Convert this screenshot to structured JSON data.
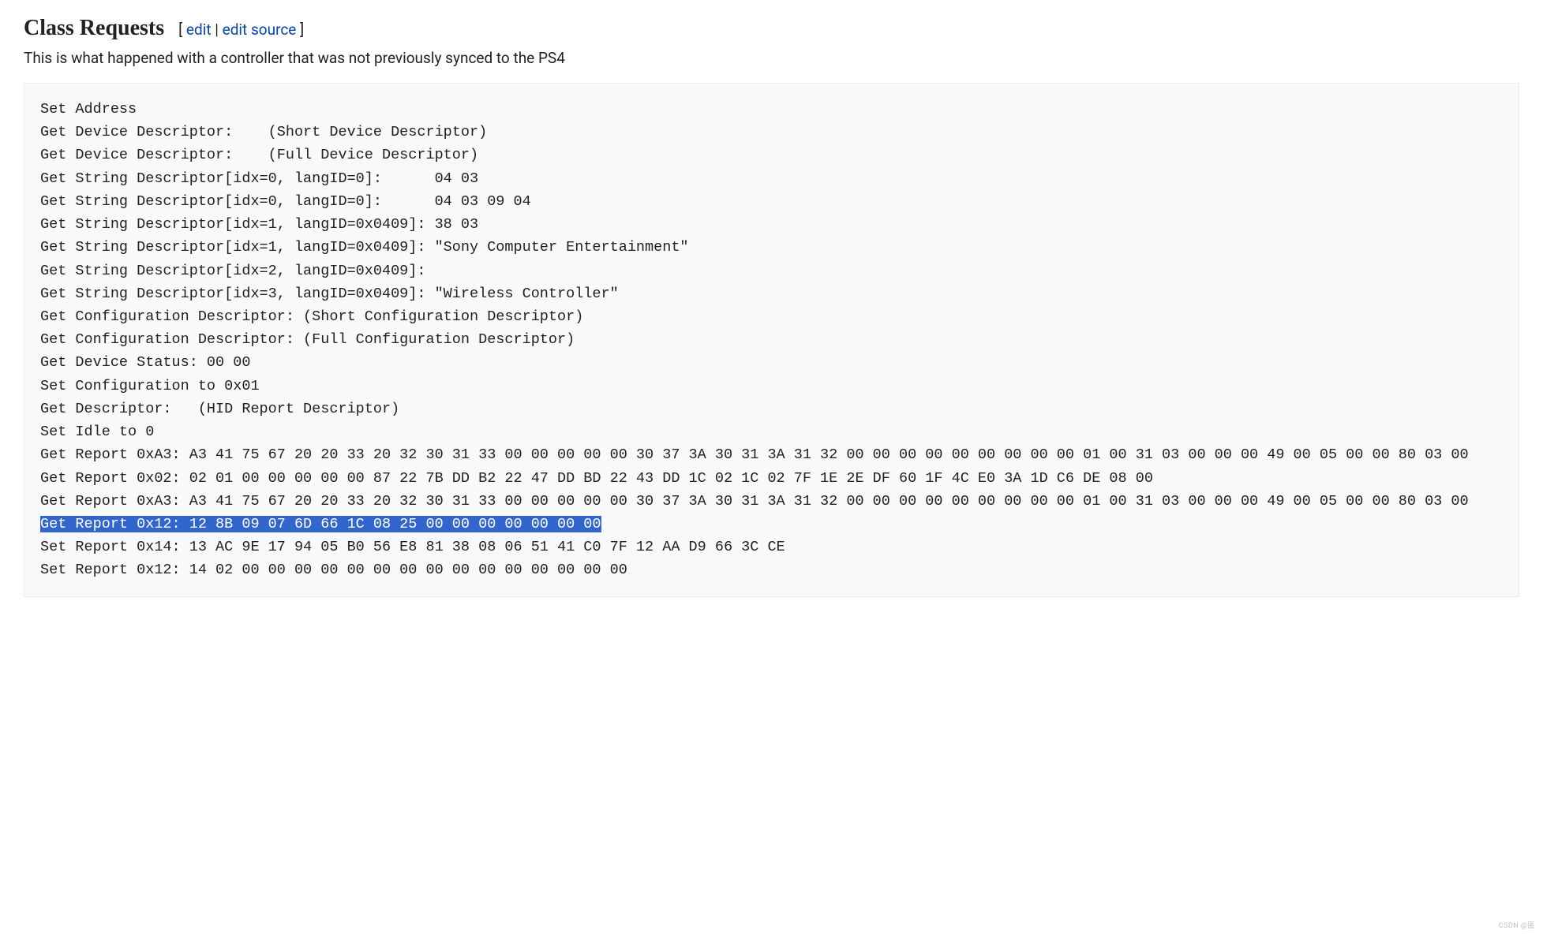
{
  "heading": "Class Requests",
  "edit": {
    "open": "[ ",
    "link1": "edit",
    "sep": " | ",
    "link2": "edit source",
    "close": " ]"
  },
  "description": "This is what happened with a controller that was not previously synced to the PS4",
  "code": {
    "l01": "Set Address",
    "l02": "Get Device Descriptor:    (Short Device Descriptor)",
    "l03": "Get Device Descriptor:    (Full Device Descriptor)",
    "l04": "Get String Descriptor[idx=0, langID=0]:      04 03",
    "l05": "Get String Descriptor[idx=0, langID=0]:      04 03 09 04",
    "l06": "Get String Descriptor[idx=1, langID=0x0409]: 38 03",
    "l07": "Get String Descriptor[idx=1, langID=0x0409]: \"Sony Computer Entertainment\"",
    "l08": "Get String Descriptor[idx=2, langID=0x0409]:",
    "l09": "Get String Descriptor[idx=3, langID=0x0409]: \"Wireless Controller\"",
    "l10": "Get Configuration Descriptor: (Short Configuration Descriptor)",
    "l11": "Get Configuration Descriptor: (Full Configuration Descriptor)",
    "l12": "Get Device Status: 00 00",
    "l13": "Set Configuration to 0x01",
    "l14": "Get Descriptor:   (HID Report Descriptor)",
    "l15": "Set Idle to 0",
    "l16": "Get Report 0xA3: A3 41 75 67 20 20 33 20 32 30 31 33 00 00 00 00 00 30 37 3A 30 31 3A 31 32 00 00 00 00 00 00 00 00 00 01 00 31 03 00 00 00 49 00 05 00 00 80 03 00",
    "l17": "Get Report 0x02: 02 01 00 00 00 00 00 87 22 7B DD B2 22 47 DD BD 22 43 DD 1C 02 1C 02 7F 1E 2E DF 60 1F 4C E0 3A 1D C6 DE 08 00",
    "l18": "Get Report 0xA3: A3 41 75 67 20 20 33 20 32 30 31 33 00 00 00 00 00 30 37 3A 30 31 3A 31 32 00 00 00 00 00 00 00 00 00 01 00 31 03 00 00 00 49 00 05 00 00 80 03 00",
    "l19": "Get Report 0x12: 12 8B 09 07 6D 66 1C 08 25 00 00 00 00 00 00 00",
    "l20": "Set Report 0x14: 13 AC 9E 17 94 05 B0 56 E8 81 38 08 06 51 41 C0 7F 12 AA D9 66 3C CE",
    "l21": "Set Report 0x12: 14 02 00 00 00 00 00 00 00 00 00 00 00 00 00 00 00"
  },
  "watermark": "CSDN @匿"
}
